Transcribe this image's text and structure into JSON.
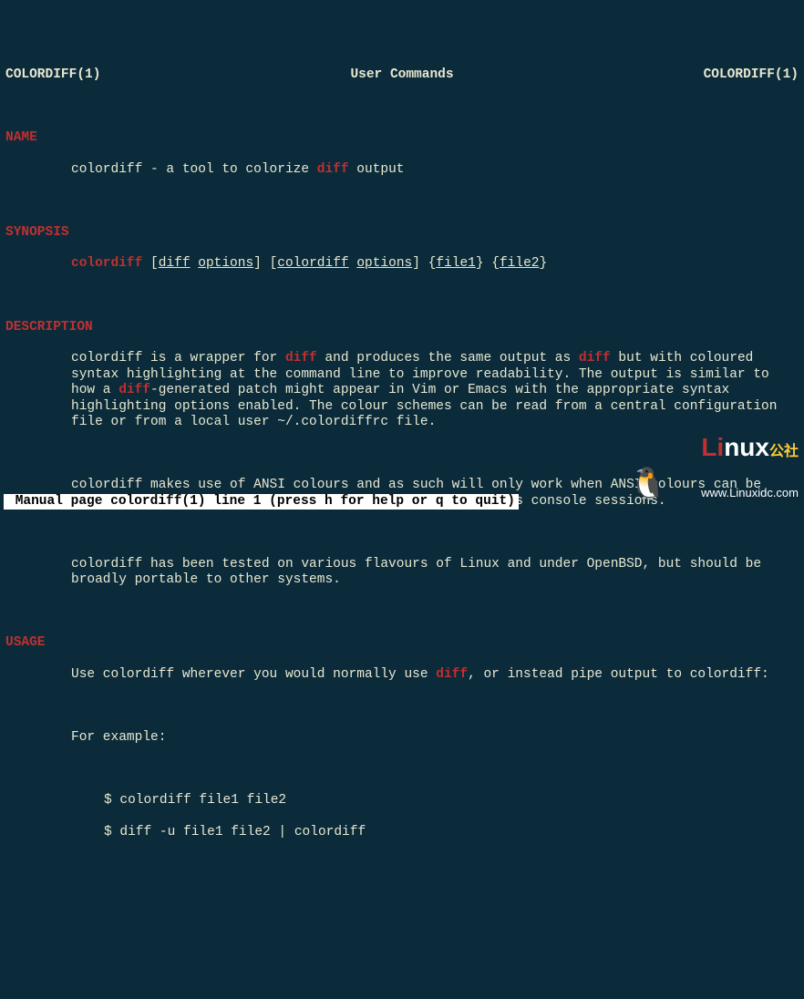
{
  "header": {
    "left": "COLORDIFF(1)",
    "center": "User Commands",
    "right": "COLORDIFF(1)"
  },
  "sections": {
    "name": "NAME",
    "synopsis": "SYNOPSIS",
    "description": "DESCRIPTION",
    "usage": "USAGE"
  },
  "name_line": {
    "pre": "colordiff - a tool to colorize ",
    "hl": "diff",
    "post": " output"
  },
  "synopsis": {
    "cmd": "colordiff",
    "l1": "[",
    "u1": "diff",
    "sp1": " ",
    "u2": "options",
    "r1": "] [",
    "u3": "colordiff",
    "sp2": " ",
    "u4": "options",
    "r2": "] {",
    "u5": "file1",
    "r3": "} {",
    "u6": "file2",
    "r4": "}"
  },
  "desc": {
    "p1_a": "colordiff is a wrapper for ",
    "p1_hl1": "diff",
    "p1_b": " and produces the same output as ",
    "p1_hl2": "diff",
    "p1_c": " but with coloured syntax highlighting at the command line to improve readability. The output is similar to how a ",
    "p1_hl3": "diff",
    "p1_d": "-generated patch might appear in Vim or Emacs with the appropriate syntax highlighting options enabled. The colour schemes can be read from a central configuration file or from a local user ~/.colordiffrc file.",
    "p2": "colordiff makes use of ANSI colours and as such will only work when ANSI colours can be used - typical examples are xterms and Eterms, as well as console sessions.",
    "p3": "colordiff has been tested on various flavours of Linux and under OpenBSD, but should be broadly portable to other systems."
  },
  "usage": {
    "p1_a": "Use colordiff wherever you would normally use ",
    "p1_hl": "diff",
    "p1_b": ", or instead pipe output to colordiff:",
    "p2": "For example:",
    "ex1": "$ colordiff file1 file2",
    "ex2": "$ diff -u file1 file2 | colordiff"
  },
  "status": " Manual page colordiff(1) line 1 (press h for help or q to quit)",
  "logo": {
    "li": "Li",
    "nux": "nux",
    "cn": "公社",
    "url": "www.Linuxidc.com"
  }
}
